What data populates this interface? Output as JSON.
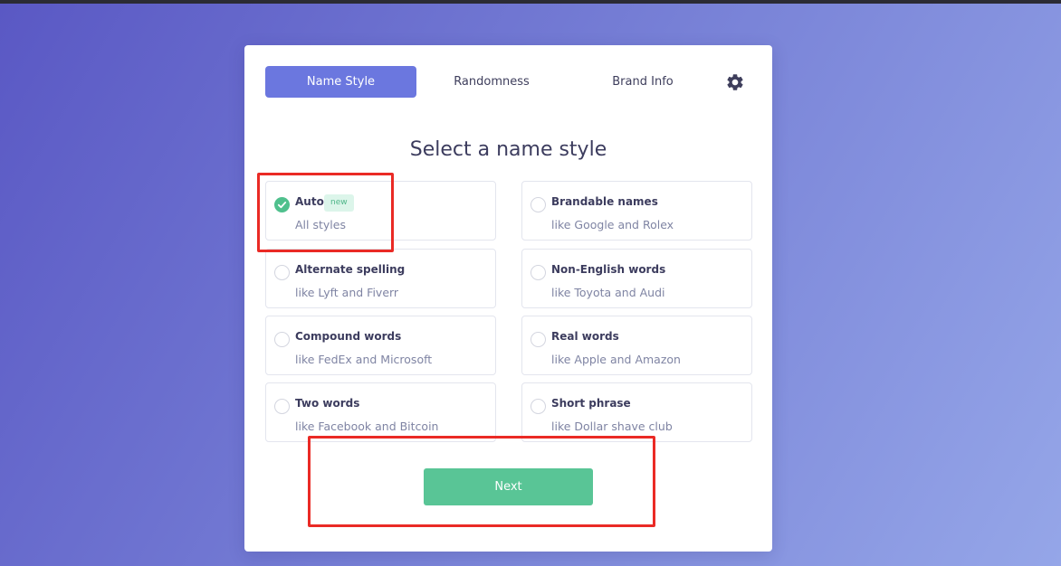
{
  "tabs": [
    {
      "label": "Name Style",
      "active": true
    },
    {
      "label": "Randomness",
      "active": false
    },
    {
      "label": "Brand Info",
      "active": false
    }
  ],
  "settings_icon": "gear-icon",
  "heading": "Select a name style",
  "options": [
    {
      "title": "Auto",
      "badge": "new",
      "subtitle": "All styles",
      "selected": true
    },
    {
      "title": "Brandable names",
      "subtitle": "like Google and Rolex",
      "selected": false
    },
    {
      "title": "Alternate spelling",
      "subtitle": "like Lyft and Fiverr",
      "selected": false
    },
    {
      "title": "Non-English words",
      "subtitle": "like Toyota and Audi",
      "selected": false
    },
    {
      "title": "Compound words",
      "subtitle": "like FedEx and Microsoft",
      "selected": false
    },
    {
      "title": "Real words",
      "subtitle": "like Apple and Amazon",
      "selected": false
    },
    {
      "title": "Two words",
      "subtitle": "like Facebook and Bitcoin",
      "selected": false
    },
    {
      "title": "Short phrase",
      "subtitle": "like Dollar shave club",
      "selected": false
    }
  ],
  "next_label": "Next",
  "colors": {
    "accent": "#6b77df",
    "success": "#59c596",
    "annotation": "#ea2a25"
  }
}
